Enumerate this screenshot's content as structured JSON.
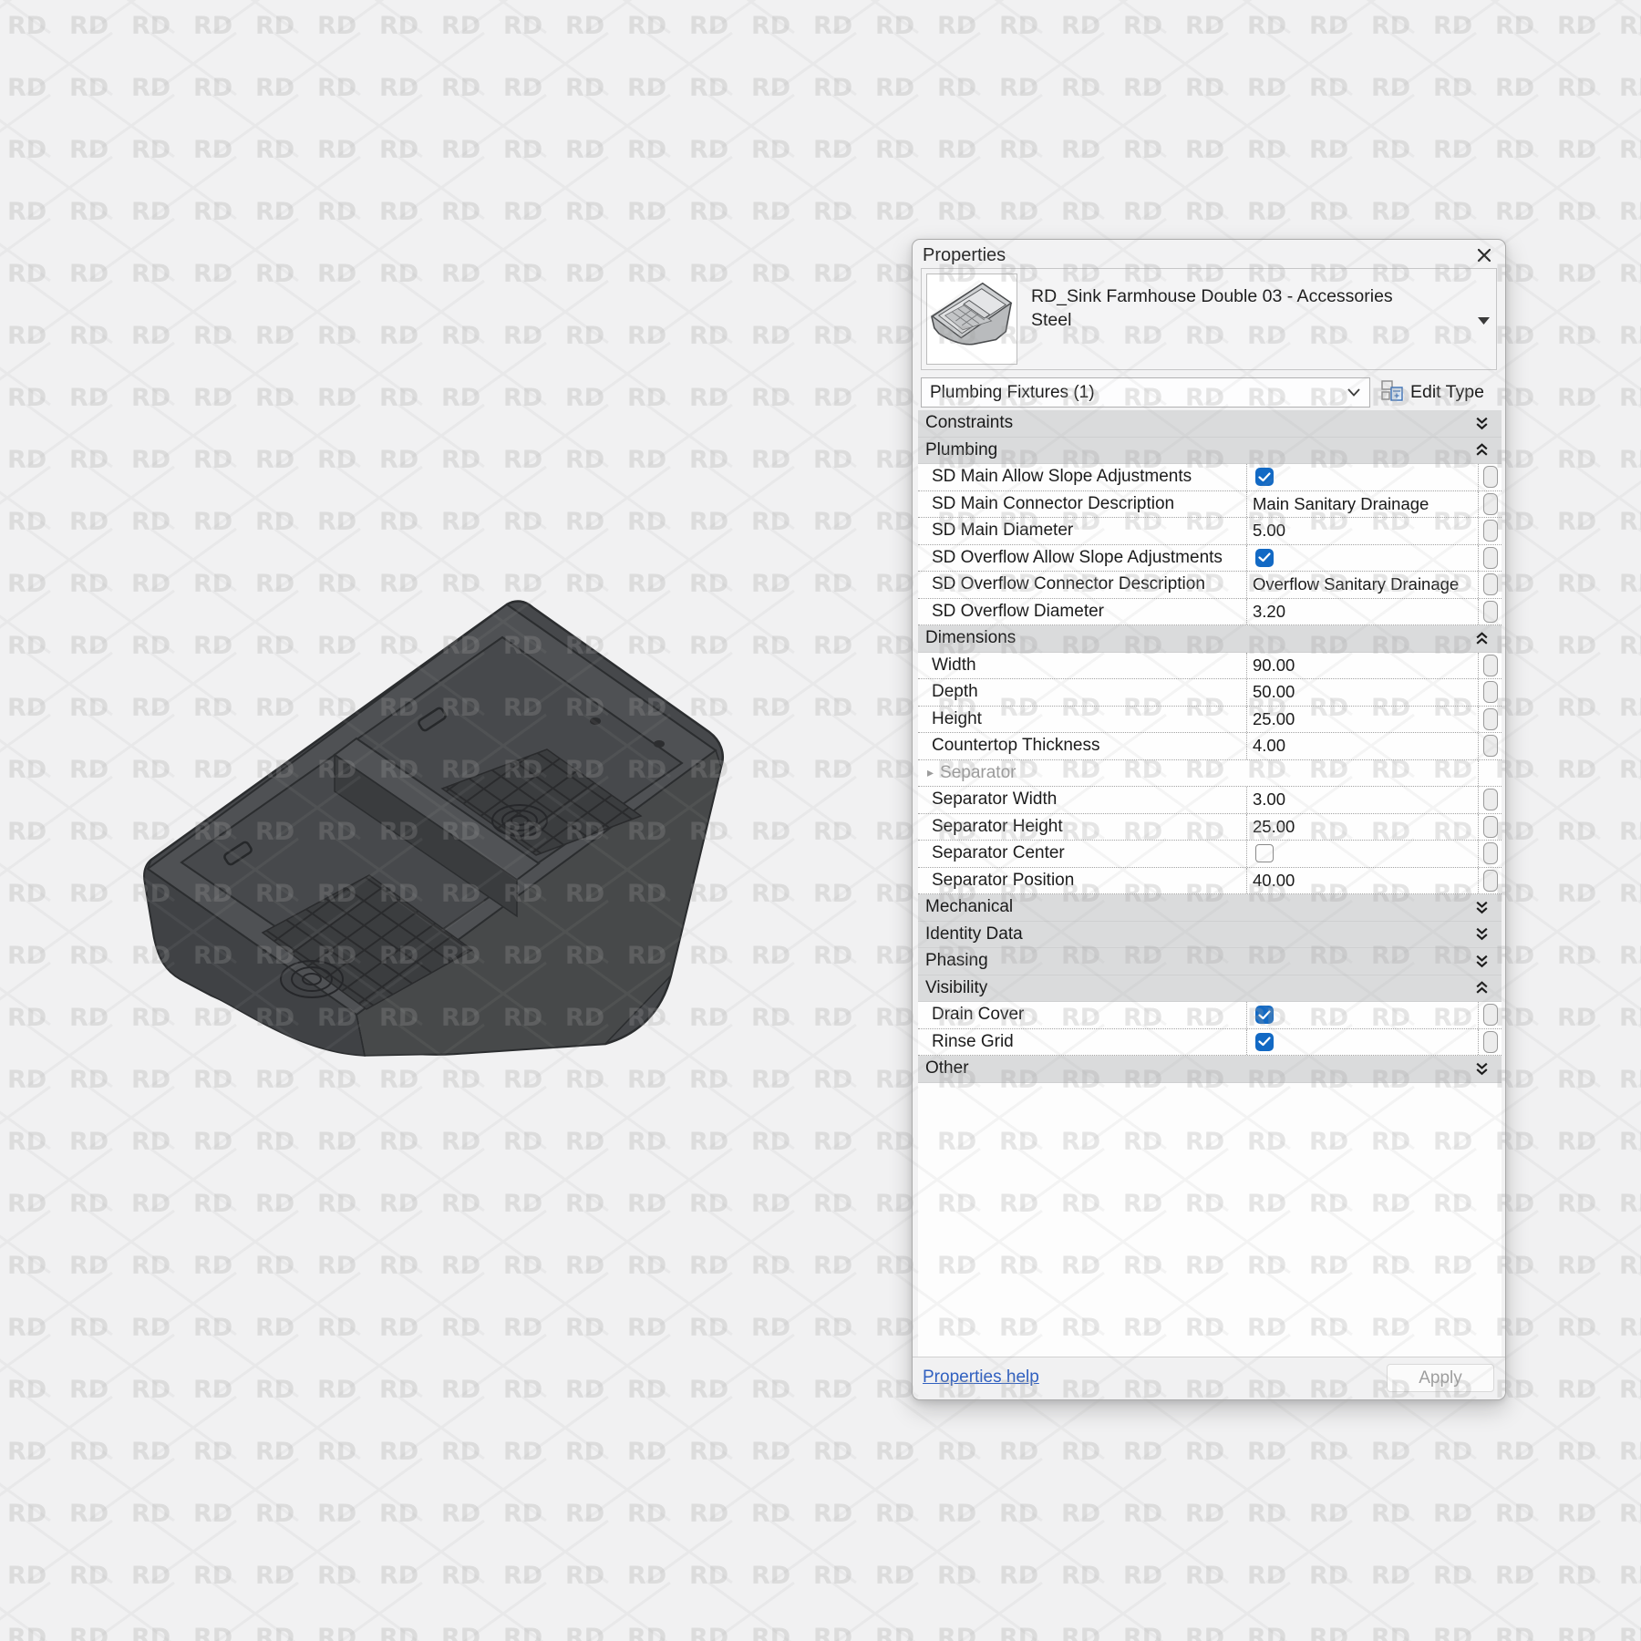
{
  "watermark": {
    "text": "RD"
  },
  "sink": {
    "description": "dark charcoal double-bowl farmhouse sink 3d render"
  },
  "colors": {
    "checkbox_accent": "#1269c4",
    "link": "#3060c0",
    "panel_bg": "#f2f2f3",
    "section_bg": "#dadbdc",
    "sink_body": "#46484b"
  },
  "panel": {
    "title": "Properties",
    "type_selector": {
      "family": "RD_Sink Farmhouse Double 03 - Accessories",
      "type": "Steel"
    },
    "category_combo": {
      "value": "Plumbing Fixtures (1)"
    },
    "edit_type_label": "Edit Type",
    "grid": {
      "rows": [
        {
          "type": "section",
          "label": "Constraints",
          "state": "collapsed"
        },
        {
          "type": "section",
          "label": "Plumbing",
          "state": "expanded"
        },
        {
          "type": "property",
          "label": "SD Main Allow Slope Adjustments",
          "value_type": "checkbox",
          "checked": true
        },
        {
          "type": "property",
          "label": "SD Main Connector Description",
          "value_type": "text",
          "value": "Main Sanitary Drainage"
        },
        {
          "type": "property",
          "label": "SD Main Diameter",
          "value_type": "text",
          "value": "5.00"
        },
        {
          "type": "property",
          "label": "SD Overflow Allow Slope Adjustments",
          "value_type": "checkbox",
          "checked": true
        },
        {
          "type": "property",
          "label": "SD Overflow Connector Description",
          "value_type": "text",
          "value": "Overflow Sanitary Drainage"
        },
        {
          "type": "property",
          "label": "SD Overflow Diameter",
          "value_type": "text",
          "value": "3.20"
        },
        {
          "type": "section",
          "label": "Dimensions",
          "state": "expanded"
        },
        {
          "type": "property",
          "label": "Width",
          "value_type": "text",
          "value": "90.00"
        },
        {
          "type": "property",
          "label": "Depth",
          "value_type": "text",
          "value": "50.00"
        },
        {
          "type": "property",
          "label": "Height",
          "value_type": "text",
          "value": "25.00"
        },
        {
          "type": "property",
          "label": "Countertop Thickness",
          "value_type": "text",
          "value": "4.00"
        },
        {
          "type": "group",
          "label": "Separator"
        },
        {
          "type": "property",
          "label": "Separator Width",
          "value_type": "text",
          "value": "3.00"
        },
        {
          "type": "property",
          "label": "Separator Height",
          "value_type": "text",
          "value": "25.00"
        },
        {
          "type": "property",
          "label": "Separator Center",
          "value_type": "checkbox",
          "checked": false
        },
        {
          "type": "property",
          "label": "Separator Position",
          "value_type": "text",
          "value": "40.00"
        },
        {
          "type": "section",
          "label": "Mechanical",
          "state": "collapsed"
        },
        {
          "type": "section",
          "label": "Identity Data",
          "state": "collapsed"
        },
        {
          "type": "section",
          "label": "Phasing",
          "state": "collapsed"
        },
        {
          "type": "section",
          "label": "Visibility",
          "state": "expanded"
        },
        {
          "type": "property",
          "label": "Drain Cover",
          "value_type": "checkbox",
          "checked": true
        },
        {
          "type": "property",
          "label": "Rinse Grid",
          "value_type": "checkbox",
          "checked": true
        },
        {
          "type": "section",
          "label": "Other",
          "state": "collapsed"
        }
      ]
    },
    "footer": {
      "help_label": "Properties help",
      "apply_label": "Apply"
    }
  }
}
